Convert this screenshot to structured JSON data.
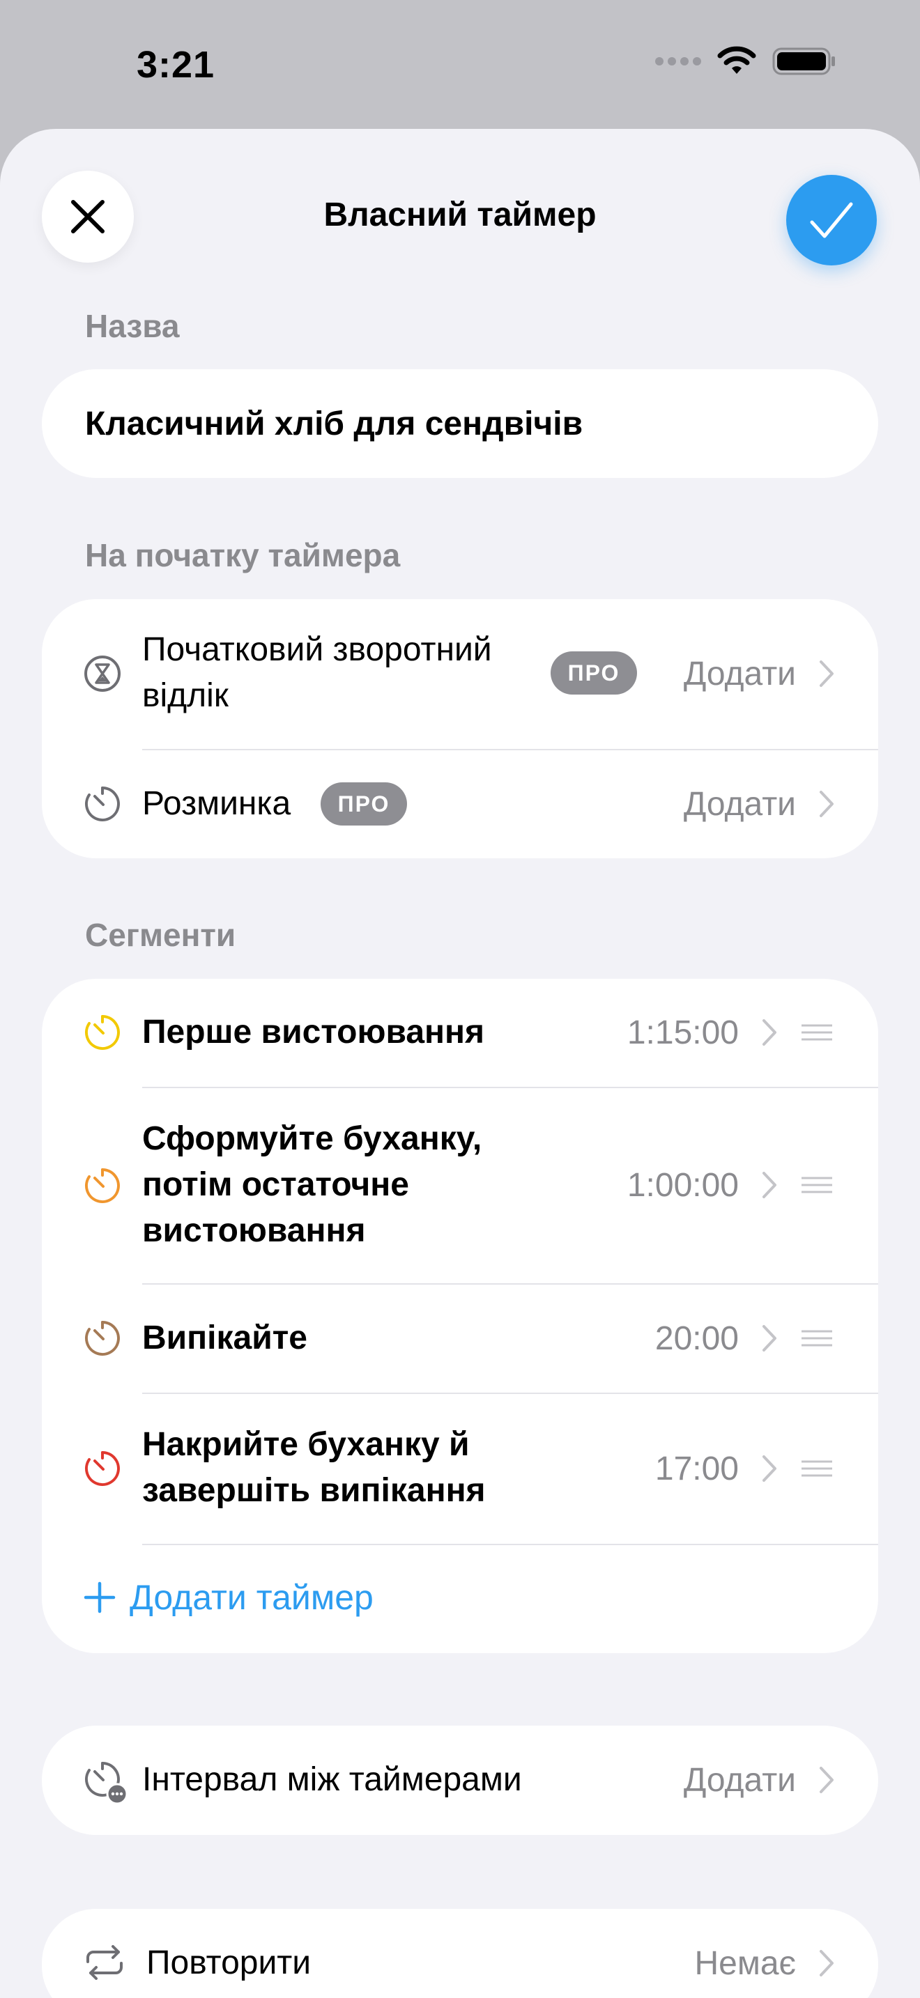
{
  "status_bar": {
    "time": "3:21"
  },
  "nav": {
    "title": "Власний таймер",
    "close_icon": "close-icon",
    "confirm_icon": "checkmark-icon"
  },
  "name_section": {
    "label": "Назва",
    "value": "Класичний хліб для сендвічів"
  },
  "start_section": {
    "label": "На початку таймера",
    "items": [
      {
        "label": "Початковий зворотний відлік",
        "badge": "ПРО",
        "value": "Додати",
        "icon": "hourglass-icon"
      },
      {
        "label": "Розминка",
        "badge": "ПРО",
        "value": "Додати",
        "icon": "stopwatch-icon"
      }
    ]
  },
  "segments_section": {
    "label": "Сегменти",
    "items": [
      {
        "label": "Перше вистоювання",
        "value": "1:15:00",
        "color": "#f2c900"
      },
      {
        "label": "Сформуйте буханку, потім остаточне вистоювання",
        "value": "1:00:00",
        "color": "#f0962e"
      },
      {
        "label": "Випікайте",
        "value": "20:00",
        "color": "#a57a55"
      },
      {
        "label": "Накрийте буханку й завершіть випікання",
        "value": "17:00",
        "color": "#e0382e"
      }
    ],
    "add_label": "Додати таймер"
  },
  "interval": {
    "label": "Інтервал між таймерами",
    "value": "Додати",
    "icon": "interval-timer-icon"
  },
  "repeat": {
    "label": "Повторити",
    "value": "Немає",
    "icon": "repeat-icon"
  },
  "colors": {
    "accent": "#2c9cf0",
    "background": "#f2f2f7",
    "secondary_text": "#8a8a8e"
  }
}
